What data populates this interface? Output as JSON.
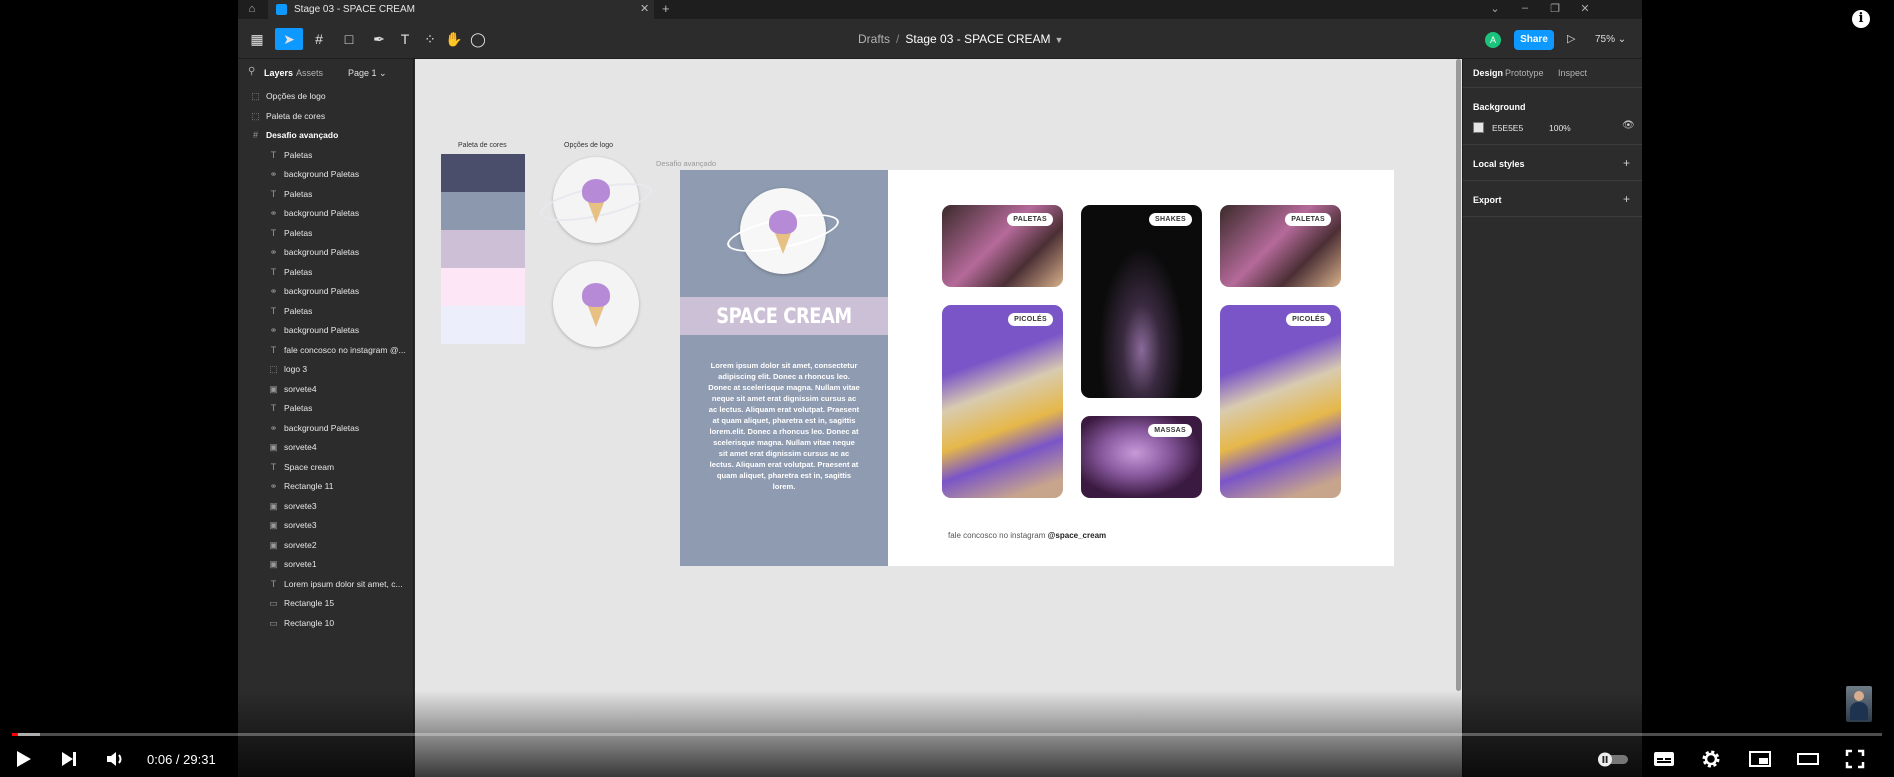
{
  "titlebar": {
    "tab_title": "Stage 03 - SPACE CREAM"
  },
  "toolbar": {
    "drafts": "Drafts",
    "separator": "/",
    "file_name": "Stage 03 - SPACE CREAM",
    "avatar_initial": "A",
    "share_label": "Share",
    "zoom": "75%"
  },
  "layers_panel": {
    "tab_layers": "Layers",
    "tab_assets": "Assets",
    "page": "Page 1",
    "items": [
      {
        "name": "Opções de logo",
        "icon": "frame-dashed-icon",
        "indent": 0,
        "bold": false
      },
      {
        "name": "Paleta de cores",
        "icon": "frame-dashed-icon",
        "indent": 0,
        "bold": false
      },
      {
        "name": "Desafio avançado",
        "icon": "frame-hash-icon",
        "indent": 0,
        "bold": true
      },
      {
        "name": "Paletas",
        "icon": "text-icon",
        "indent": 1,
        "bold": false
      },
      {
        "name": "background Paletas",
        "icon": "line-icon",
        "indent": 1,
        "bold": false
      },
      {
        "name": "Paletas",
        "icon": "text-icon",
        "indent": 1,
        "bold": false
      },
      {
        "name": "background Paletas",
        "icon": "line-icon",
        "indent": 1,
        "bold": false
      },
      {
        "name": "Paletas",
        "icon": "text-icon",
        "indent": 1,
        "bold": false
      },
      {
        "name": "background Paletas",
        "icon": "line-icon",
        "indent": 1,
        "bold": false
      },
      {
        "name": "Paletas",
        "icon": "text-icon",
        "indent": 1,
        "bold": false
      },
      {
        "name": "background Paletas",
        "icon": "line-icon",
        "indent": 1,
        "bold": false
      },
      {
        "name": "Paletas",
        "icon": "text-icon",
        "indent": 1,
        "bold": false
      },
      {
        "name": "background Paletas",
        "icon": "line-icon",
        "indent": 1,
        "bold": false
      },
      {
        "name": "fale concosco no instagram @...",
        "icon": "text-icon",
        "indent": 1,
        "bold": false
      },
      {
        "name": "logo 3",
        "icon": "frame-dashed-icon",
        "indent": 1,
        "bold": false
      },
      {
        "name": "sorvete4",
        "icon": "image-icon",
        "indent": 1,
        "bold": false
      },
      {
        "name": "Paletas",
        "icon": "text-icon",
        "indent": 1,
        "bold": false
      },
      {
        "name": "background Paletas",
        "icon": "line-icon",
        "indent": 1,
        "bold": false
      },
      {
        "name": "sorvete4",
        "icon": "image-icon",
        "indent": 1,
        "bold": false
      },
      {
        "name": "Space cream",
        "icon": "text-icon",
        "indent": 1,
        "bold": false
      },
      {
        "name": "Rectangle 11",
        "icon": "line-icon",
        "indent": 1,
        "bold": false
      },
      {
        "name": "sorvete3",
        "icon": "image-icon",
        "indent": 1,
        "bold": false
      },
      {
        "name": "sorvete3",
        "icon": "image-icon",
        "indent": 1,
        "bold": false
      },
      {
        "name": "sorvete2",
        "icon": "image-icon",
        "indent": 1,
        "bold": false
      },
      {
        "name": "sorvete1",
        "icon": "image-icon",
        "indent": 1,
        "bold": false
      },
      {
        "name": "Lorem ipsum dolor sit amet, c...",
        "icon": "text-icon",
        "indent": 1,
        "bold": false
      },
      {
        "name": "Rectangle 15",
        "icon": "rectangle-icon",
        "indent": 1,
        "bold": false
      },
      {
        "name": "Rectangle 10",
        "icon": "rectangle-icon",
        "indent": 1,
        "bold": false
      }
    ]
  },
  "canvas": {
    "palette_label": "Paleta de cores",
    "logo_options_label": "Opções de logo",
    "frame_label": "Desafio avançado",
    "palette_colors": [
      "#4a4e6b",
      "#8b98ae",
      "#cdc0d6",
      "#fde6f5",
      "#eceefc"
    ],
    "brand_title": "SPACE CREAM",
    "lorem": "Lorem ipsum dolor sit amet, consectetur adipiscing elit. Donec a rhoncus leo. Donec at scelerisque magna. Nullam vitae neque sit amet erat dignissim cursus ac ac lectus. Aliquam erat volutpat. Praesent at quam aliquet, pharetra est in, sagittis lorem.elit. Donec a rhoncus leo. Donec at scelerisque magna. Nullam vitae neque sit amet erat dignissim cursus ac ac lectus. Aliquam erat volutpat. Praesent at quam aliquet, pharetra est in, sagittis lorem.",
    "tags": {
      "paletas_1": "PALETAS",
      "shakes": "SHAKES",
      "paletas_2": "PALETAS",
      "picoles_1": "PICOLÉS",
      "massas": "MASSAS",
      "picoles_2": "PICOLÉS"
    },
    "footer_prefix": "fale concosco no instagram",
    "footer_handle": "@space_cream"
  },
  "design_panel": {
    "tab_design": "Design",
    "tab_prototype": "Prototype",
    "tab_inspect": "Inspect",
    "background_label": "Background",
    "bg_hex": "E5E5E5",
    "bg_opacity": "100%",
    "local_styles": "Local styles",
    "export": "Export"
  },
  "player": {
    "time": "0:06 / 29:31",
    "progress_fraction": 0.0034,
    "buffered_fraction": 0.015
  }
}
